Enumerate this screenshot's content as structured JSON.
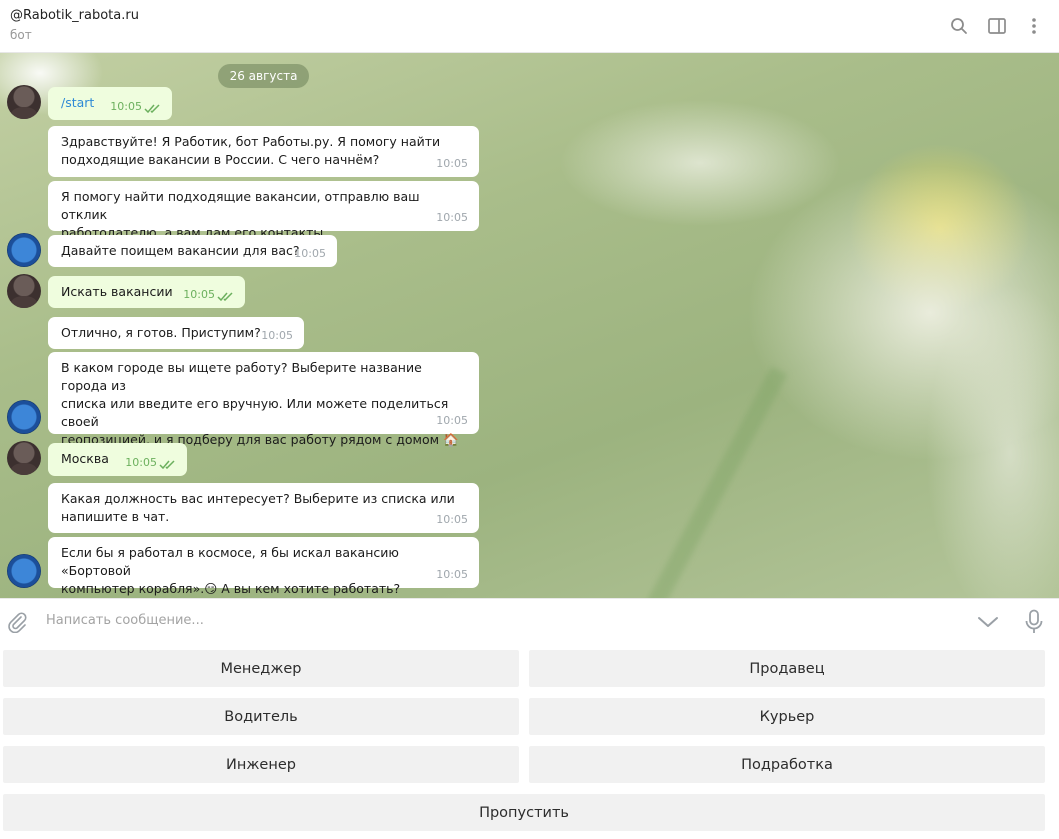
{
  "header": {
    "title": "@Rabotik_rabota.ru",
    "subtitle": "бот",
    "icons": [
      "search-icon",
      "sidebar-toggle-icon",
      "more-vertical-icon"
    ]
  },
  "chat": {
    "date_chip": "26 августа",
    "messages": [
      {
        "from": "user",
        "text": "/start",
        "time": "10:05",
        "read": true
      },
      {
        "from": "bot",
        "text": "Здравствуйте! Я Работик, бот Работы.ру. Я помогу найти\nподходящие вакансии в России. С чего начнём?",
        "time": "10:05"
      },
      {
        "from": "bot",
        "text": "Я помогу найти подходящие вакансии, отправлю ваш отклик\nработодателю, а вам дам его контакты.",
        "time": "10:05"
      },
      {
        "from": "bot",
        "text": "Давайте поищем вакансии для вас?",
        "time": "10:05"
      },
      {
        "from": "user",
        "text": "Искать вакансии",
        "time": "10:05",
        "read": true
      },
      {
        "from": "bot",
        "text": "Отлично, я готов. Приступим?",
        "time": "10:05"
      },
      {
        "from": "bot",
        "text": "В каком городе вы ищете работу? Выберите название города из\nсписка или введите его вручную. Или можете поделиться своей\nгеопозицией, и я подберу для вас работу рядом с домом 🏠",
        "time": "10:05"
      },
      {
        "from": "user",
        "text": "Москва",
        "time": "10:05",
        "read": true
      },
      {
        "from": "bot",
        "text": "Какая должность вас интересует? Выберите из списка или\nнапишите в чат.",
        "time": "10:05"
      },
      {
        "from": "bot",
        "text": "Если бы я работал в космосе, я бы искал вакансию «Бортовой\nкомпьютер корабля».😏 А вы кем хотите работать?",
        "time": "10:05"
      }
    ]
  },
  "composer": {
    "placeholder": "Написать сообщение...",
    "icons": [
      "paperclip-icon",
      "chevron-down-icon",
      "microphone-icon"
    ]
  },
  "keyboard": {
    "buttons": [
      "Менеджер",
      "Продавец",
      "Водитель",
      "Курьер",
      "Инженер",
      "Подработка",
      "Пропустить"
    ]
  },
  "colors": {
    "incoming_bubble": "#ffffff",
    "outgoing_bubble": "#effdde",
    "link": "#2e8ad6",
    "read_check": "#6cb05e",
    "keyboard_button": "#f1f1f1"
  }
}
